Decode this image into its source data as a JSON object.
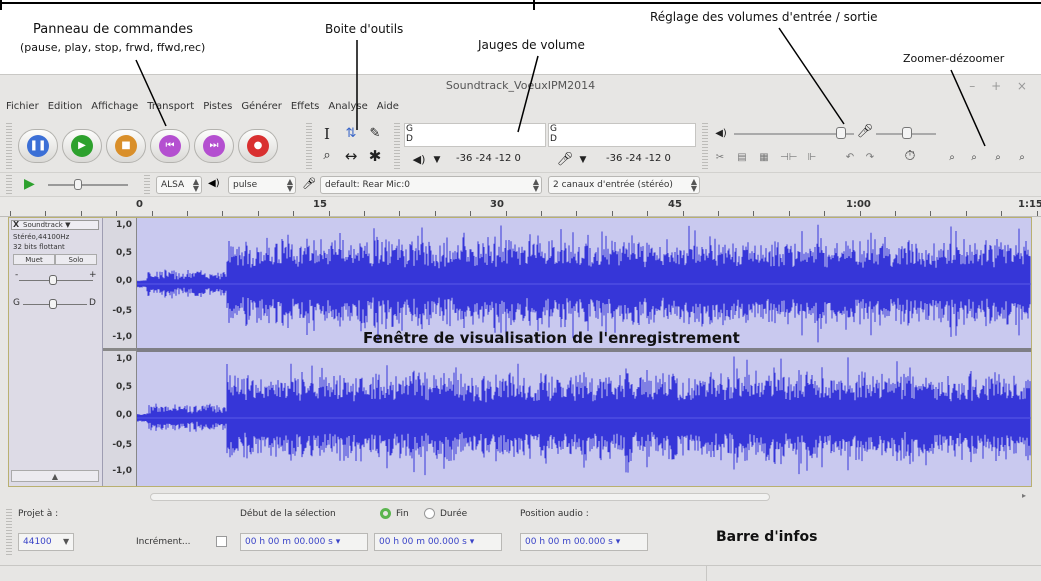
{
  "annotations": {
    "panneau_title": "Panneau de commandes",
    "panneau_sub": "(pause, play, stop, frwd, ffwd,rec)",
    "boite_outils": "Boite d'outils",
    "jauges": "Jauges de volume",
    "reglage": "Réglage des volumes d'entrée / sortie",
    "zoom": "Zoomer-dézoomer",
    "fenetre": "Fenêtre de visualisation de l'enregistrement",
    "barre_infos": "Barre d'infos"
  },
  "window": {
    "title": "Soundtrack_VoeuxIPM2014",
    "controls": "– + ×"
  },
  "menu": [
    "Fichier",
    "Edition",
    "Affichage",
    "Transport",
    "Pistes",
    "Générer",
    "Effets",
    "Analyse",
    "Aide"
  ],
  "transport": [
    {
      "name": "pause",
      "color": "#3b6fd6",
      "glyph": "❚❚"
    },
    {
      "name": "play",
      "color": "#2da12d",
      "glyph": "▶"
    },
    {
      "name": "stop",
      "color": "#d98f2a",
      "glyph": "■"
    },
    {
      "name": "skip-start",
      "color": "#b44fd0",
      "glyph": "⏮"
    },
    {
      "name": "skip-end",
      "color": "#b44fd0",
      "glyph": "⏭"
    },
    {
      "name": "record",
      "color": "#d93030",
      "glyph": "●"
    }
  ],
  "tools": {
    "select": "I",
    "envelope": "⇅",
    "draw": "✎",
    "zoom": "⌕",
    "timeshift": "↔",
    "multi": "✱"
  },
  "meters": {
    "play_lr": [
      "G",
      "D"
    ],
    "rec_lr": [
      "G",
      "D"
    ],
    "scale_play": "-36  -24  -12  0",
    "scale_rec": "-36  -24  -12  0"
  },
  "device": {
    "host": "ALSA",
    "output": "pulse",
    "input": "default: Rear Mic:0",
    "channels": "2 canaux d'entrée (stéréo)"
  },
  "ruler": [
    "0",
    "15",
    "30",
    "45",
    "1:00",
    "1:15"
  ],
  "track": {
    "name": "Soundtrack ▼",
    "format": "Stéréo,44100Hz",
    "bits": "32 bits flottant",
    "mute": "Muet",
    "solo": "Solo",
    "gain_minus": "-",
    "gain_plus": "+",
    "pan_left": "G",
    "pan_right": "D",
    "close": "X",
    "collapse": "▲",
    "scale": [
      "1,0",
      "0,5",
      "0,0",
      "-0,5",
      "-1,0"
    ],
    "wave_color": "#3636d8",
    "wave_bg": "#c9c9ef"
  },
  "info": {
    "project_label": "Projet à :",
    "project_rate": "44100",
    "increment_label": "Incrément...",
    "selection_label": "Début de la sélection",
    "end_label": "Fin",
    "duration_label": "Durée",
    "audio_pos_label": "Position audio :",
    "time1": "00 h 00 m 00.000 s",
    "time2": "00 h 00 m 00.000 s",
    "time3": "00 h 00 m 00.000 s"
  }
}
